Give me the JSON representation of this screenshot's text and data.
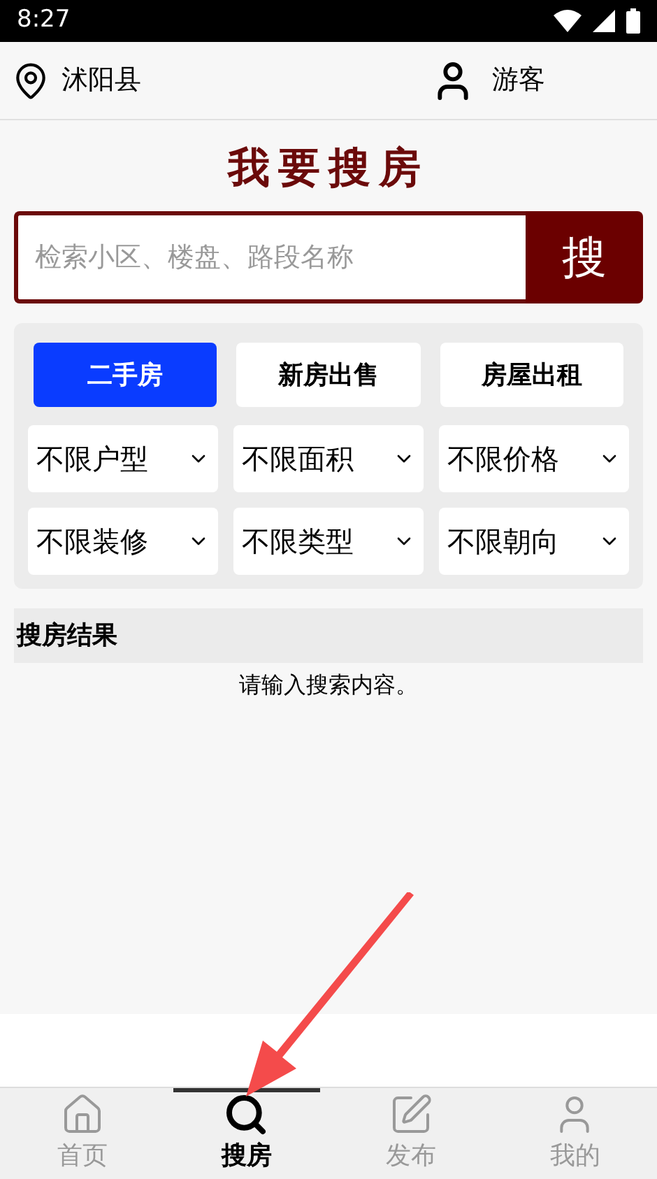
{
  "status_bar": {
    "time": "8:27"
  },
  "header": {
    "location": "沭阳县",
    "user": "游客"
  },
  "title": "我要搜房",
  "search": {
    "placeholder": "检索小区、楼盘、路段名称",
    "button": "搜"
  },
  "tabs": [
    {
      "label": "二手房",
      "selected": true
    },
    {
      "label": "新房出售",
      "selected": false
    },
    {
      "label": "房屋出租",
      "selected": false
    }
  ],
  "filters": [
    "不限户型",
    "不限面积",
    "不限价格",
    "不限装修",
    "不限类型",
    "不限朝向"
  ],
  "results": {
    "title": "搜房结果",
    "message": "请输入搜索内容。"
  },
  "nav": [
    {
      "kind": "home",
      "label": "首页",
      "selected": false
    },
    {
      "kind": "search",
      "label": "搜房",
      "selected": true
    },
    {
      "kind": "post",
      "label": "发布",
      "selected": false
    },
    {
      "kind": "me",
      "label": "我的",
      "selected": false
    }
  ]
}
